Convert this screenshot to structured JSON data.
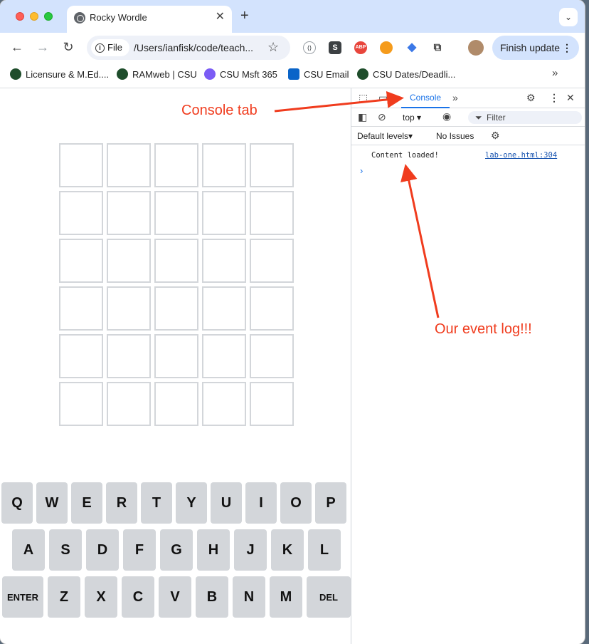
{
  "browser": {
    "tab_title": "Rocky Wordle",
    "tab_close": "✕",
    "new_tab": "+",
    "tab_search": "⌄",
    "scheme_chip": "File",
    "url": "/Users/ianfisk/code/teach...",
    "finish_update": "Finish update",
    "bookmarks": [
      {
        "label": "Licensure & M.Ed....",
        "icon": "csu-ram-icon",
        "color": "#1e4d2b"
      },
      {
        "label": "RAMweb | CSU",
        "icon": "csu-ram-icon",
        "color": "#1e4d2b"
      },
      {
        "label": "CSU Msft 365",
        "icon": "microsoft365-icon",
        "color": "#7b5cf5"
      },
      {
        "label": "CSU Email",
        "icon": "outlook-icon",
        "color": "#0a64c8"
      },
      {
        "label": "CSU Dates/Deadli...",
        "icon": "csu-ram-icon",
        "color": "#1e4d2b"
      }
    ],
    "extensions": [
      {
        "name": "code-extension-icon",
        "glyph": "⟨⟩",
        "color": "#9aa0a6"
      },
      {
        "name": "s-extension-icon",
        "glyph": "S",
        "color": "#3c4043"
      },
      {
        "name": "adblock-plus-icon",
        "glyph": "ABP",
        "color": "#e8453c"
      },
      {
        "name": "orange-extension-icon",
        "glyph": "●",
        "color": "#f59b1c"
      },
      {
        "name": "graduation-cap-icon",
        "glyph": "◆",
        "color": "#3b78e7"
      }
    ]
  },
  "game": {
    "rows": 6,
    "cols": 5,
    "keyboard": [
      [
        "Q",
        "W",
        "E",
        "R",
        "T",
        "Y",
        "U",
        "I",
        "O",
        "P"
      ],
      [
        "A",
        "S",
        "D",
        "F",
        "G",
        "H",
        "J",
        "K",
        "L"
      ],
      [
        "ENTER",
        "Z",
        "X",
        "C",
        "V",
        "B",
        "N",
        "M",
        "DEL"
      ]
    ]
  },
  "devtools": {
    "console_tab": "Console",
    "context": "top",
    "filter_placeholder": "Filter",
    "levels": "Default levels",
    "issues": "No Issues",
    "log_message": "Content loaded!",
    "log_source": "lab-one.html:304",
    "prompt": "›"
  },
  "annotations": {
    "console_tab_label": "Console tab",
    "event_log_label": "Our event log!!!",
    "color": "#f03c1e"
  }
}
